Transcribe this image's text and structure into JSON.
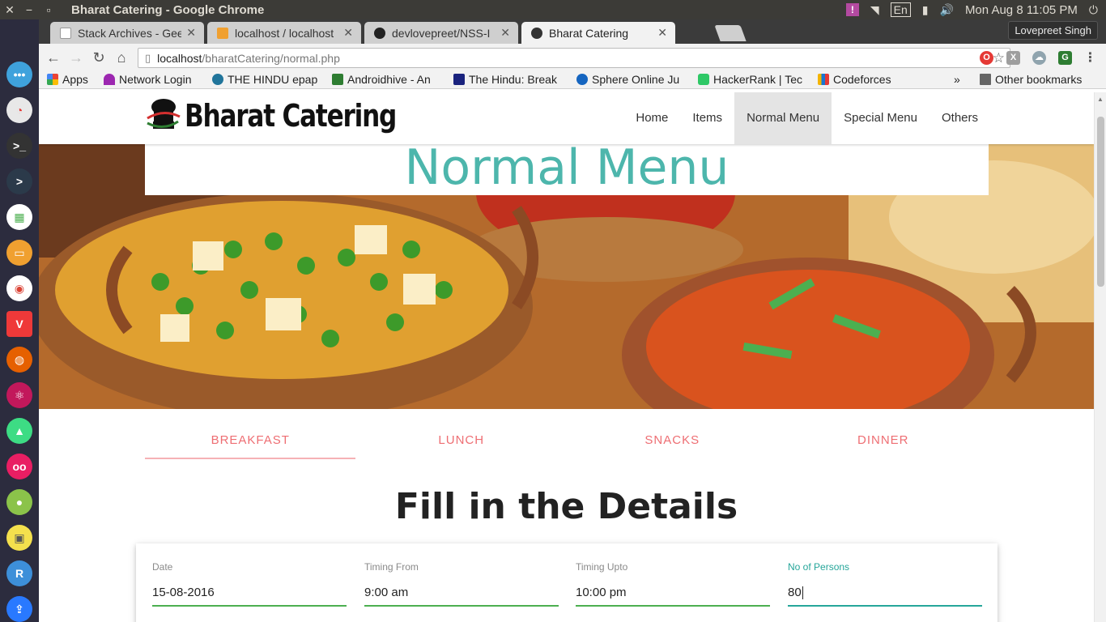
{
  "os": {
    "window_title": "Bharat Catering - Google Chrome",
    "keyboard": "En",
    "clock": "Mon Aug  8 11:05 PM"
  },
  "browser": {
    "tabs": [
      {
        "label": "Stack Archives - Gee",
        "favicon_color": "#9e9e9e"
      },
      {
        "label": "localhost / localhost",
        "favicon_color": "#f0a030"
      },
      {
        "label": "devlovepreet/NSS-I",
        "favicon_color": "#222222"
      },
      {
        "label": "Bharat Catering",
        "favicon_color": "#333333"
      }
    ],
    "profile": "Lovepreet Singh",
    "url_host": "localhost",
    "url_path": "/bharatCatering/normal.php",
    "bookmarks": [
      {
        "label": "Apps",
        "icon": "apps-grid-icon",
        "color": "#4285f4"
      },
      {
        "label": "Network Login",
        "icon": "umbrella-icon",
        "color": "#9c27b0"
      },
      {
        "label": "THE HINDU epap",
        "icon": "wordpress-icon",
        "color": "#21759b"
      },
      {
        "label": "Androidhive - An",
        "icon": "androidhive-icon",
        "color": "#2e7d32"
      },
      {
        "label": "The Hindu: Break",
        "icon": "th-icon",
        "color": "#1a237e"
      },
      {
        "label": "Sphere Online Ju",
        "icon": "spoj-icon",
        "color": "#1565c0"
      },
      {
        "label": "HackerRank | Tec",
        "icon": "hackerrank-icon",
        "color": "#2ec866"
      },
      {
        "label": "Codeforces",
        "icon": "codeforces-icon",
        "color": "#f4b400"
      }
    ],
    "bookmarks_overflow": "»",
    "other_bookmarks": "Other bookmarks"
  },
  "site": {
    "brand": "Bharat Catering",
    "nav": [
      "Home",
      "Items",
      "Normal Menu",
      "Special Menu",
      "Others"
    ],
    "active_nav": "Normal Menu",
    "hero_title": "Normal Menu",
    "menu_tabs": [
      "BREAKFAST",
      "LUNCH",
      "SNACKS",
      "DINNER"
    ],
    "active_menu_tab": "BREAKFAST",
    "section_title": "Fill in the Details",
    "form": {
      "date": {
        "label": "Date",
        "value": "15-08-2016"
      },
      "timing_from": {
        "label": "Timing From",
        "value": "9:00 am"
      },
      "timing_upto": {
        "label": "Timing Upto",
        "value": "10:00 pm"
      },
      "persons": {
        "label": "No of Persons",
        "value": "80"
      }
    }
  },
  "colors": {
    "accent_teal": "#4db6ac",
    "tab_pink": "#ee6e73",
    "field_green": "#4caf50",
    "field_focus": "#26a69a"
  }
}
